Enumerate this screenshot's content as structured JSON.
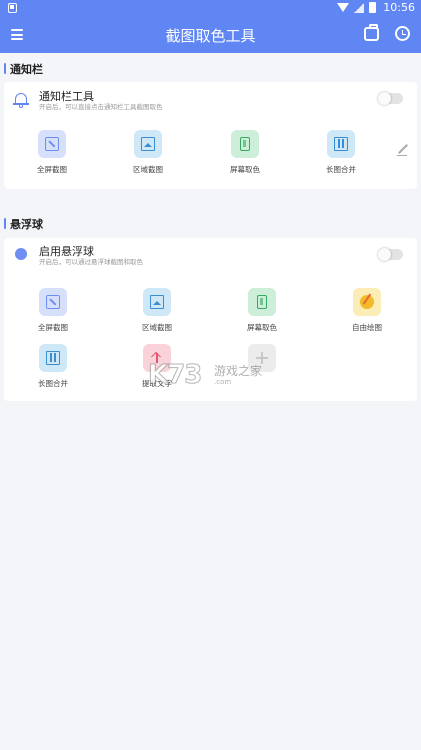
{
  "status_bar": {
    "time": "10:56"
  },
  "app_bar": {
    "title": "截图取色工具"
  },
  "notification_section": {
    "title": "通知栏",
    "row": {
      "title": "通知栏工具",
      "subtitle": "开启后，可以直接点击通知栏工具截图取色",
      "enabled": false
    },
    "tools": [
      {
        "label": "全屏截图",
        "icon": "fullscreen-screenshot-icon"
      },
      {
        "label": "区域截图",
        "icon": "area-screenshot-icon"
      },
      {
        "label": "屏幕取色",
        "icon": "screen-color-picker-icon"
      },
      {
        "label": "长图合并",
        "icon": "long-image-merge-icon"
      }
    ]
  },
  "floating_section": {
    "title": "悬浮球",
    "row": {
      "title": "启用悬浮球",
      "subtitle": "开启后，可以通过悬浮球截图和取色",
      "enabled": false
    },
    "tools": [
      {
        "label": "全屏截图",
        "icon": "fullscreen-screenshot-icon"
      },
      {
        "label": "区域截图",
        "icon": "area-screenshot-icon"
      },
      {
        "label": "屏幕取色",
        "icon": "screen-color-picker-icon"
      },
      {
        "label": "自由绘图",
        "icon": "free-drawing-icon"
      },
      {
        "label": "长图合并",
        "icon": "long-image-merge-icon"
      },
      {
        "label": "提取文字",
        "icon": "upload-icon"
      },
      {
        "label": "",
        "icon": "add-icon"
      }
    ]
  },
  "watermark": {
    "logo": "K73",
    "text": "游戏之家",
    "url": ".com"
  },
  "colors": {
    "primary": "#5f86f2",
    "background": "#f3f5f9"
  }
}
